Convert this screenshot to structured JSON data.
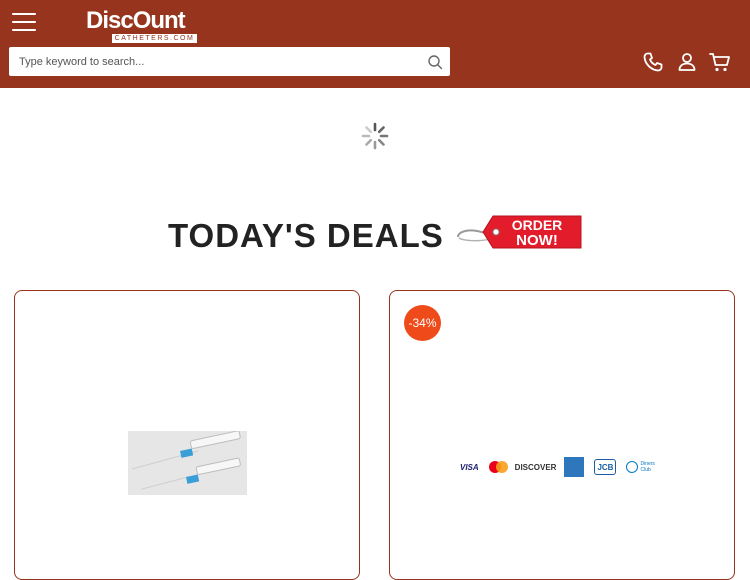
{
  "header": {
    "logo_main": "DiscOunt",
    "logo_sub": "CATHETERS.COM"
  },
  "search": {
    "placeholder": "Type keyword to search..."
  },
  "deals": {
    "title": "TODAY'S DEALS",
    "tag_line1": "ORDER",
    "tag_line2": "NOW!"
  },
  "products": [
    {
      "badge": ""
    },
    {
      "badge": "-34%"
    }
  ],
  "payment_methods": [
    "VISA",
    "DISCOVER",
    "JCB",
    "Diners Club"
  ],
  "colors": {
    "header_bg": "#96341d",
    "badge_bg": "#ef4a1a",
    "tag_red": "#e21c2a"
  },
  "icons": [
    "menu-icon",
    "search-icon",
    "phone-icon",
    "user-icon",
    "cart-icon",
    "loading-spinner-icon"
  ]
}
